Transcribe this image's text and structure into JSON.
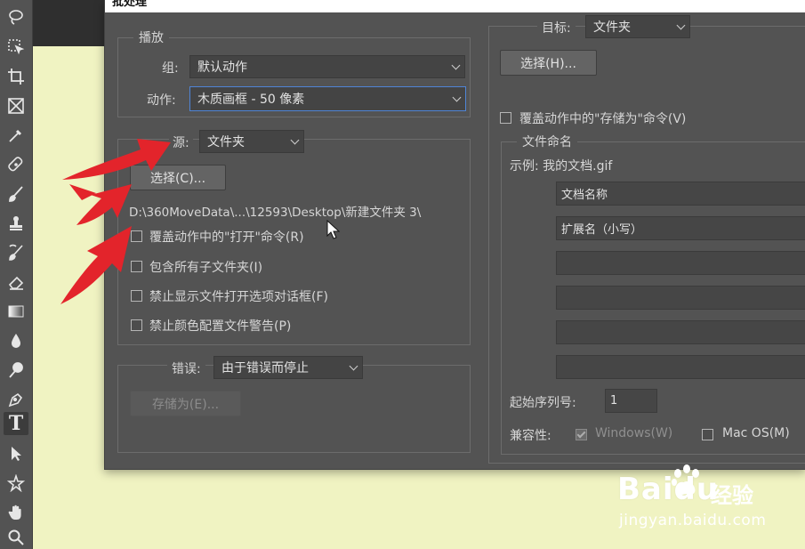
{
  "dialog": {
    "title": "批处理"
  },
  "play": {
    "group_title": "播放",
    "set_label": "组:",
    "set_value": "默认动作",
    "action_label": "动作:",
    "action_value": "木质画框 - 50 像素"
  },
  "source": {
    "label": "源:",
    "value": "文件夹",
    "choose_button": "选择(C)...",
    "path": "D:\\360MoveData\\...\\12593\\Desktop\\新建文件夹 3\\",
    "options": [
      {
        "label": "覆盖动作中的\"打开\"命令(R)",
        "checked": false
      },
      {
        "label": "包含所有子文件夹(I)",
        "checked": false
      },
      {
        "label": "禁止显示文件打开选项对话框(F)",
        "checked": false
      },
      {
        "label": "禁止颜色配置文件警告(P)",
        "checked": false
      }
    ]
  },
  "errors": {
    "label": "错误:",
    "value": "由于错误而停止",
    "save_as_button": "存储为(E)..."
  },
  "destination": {
    "label": "目标:",
    "value": "文件夹",
    "choose_button": "选择(H)...",
    "override_save_as": "覆盖动作中的\"存储为\"命令(V)"
  },
  "file_naming": {
    "title": "文件命名",
    "example": "示例: 我的文档.gif",
    "fields": [
      "文档名称",
      "扩展名（小写）",
      "",
      "",
      "",
      ""
    ],
    "serial_label": "起始序列号:",
    "serial_value": "1",
    "compat_label": "兼容性:",
    "compat_windows": "Windows(W)",
    "compat_mac": "Mac OS(M)"
  },
  "watermark": {
    "brand": "Bai",
    "brand_suffix": "du",
    "product": "经验",
    "url": "jingyan.baidu.com"
  },
  "colors": {
    "dialog_bg": "#535353",
    "canvas_bg": "#f0f3c2",
    "arrow_red": "#e3242b",
    "focus_blue": "#4f84d6"
  }
}
